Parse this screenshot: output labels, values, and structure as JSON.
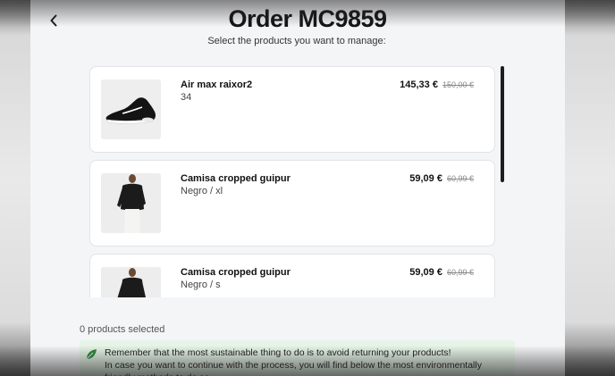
{
  "header": {
    "title": "Order MC9859",
    "subtitle": "Select the products you want to manage:"
  },
  "products": [
    {
      "name": "Air max raixor2",
      "variant": "34",
      "price": "145,33 €",
      "old_price": "150,00 €",
      "thumbnail": "sneaker-image"
    },
    {
      "name": "Camisa cropped guipur",
      "variant": "Negro / xl",
      "price": "59,09 €",
      "old_price": "60,99 €",
      "thumbnail": "shirt-image"
    },
    {
      "name": "Camisa cropped guipur",
      "variant": "Negro / s",
      "price": "59,09 €",
      "old_price": "60,99 €",
      "thumbnail": "shirt-image"
    }
  ],
  "footer": {
    "selected_count": "0 products selected",
    "notice_line1": "Remember that the most sustainable thing to do is to avoid returning your products!",
    "notice_line2": "In case you want to continue with the process, you will find below the most environmentally friendly methods to do so."
  },
  "colors": {
    "notice_bg": "#e6f4e7",
    "leaf_icon": "#2e8b3a",
    "scrollbar": "#1d1d1d"
  }
}
